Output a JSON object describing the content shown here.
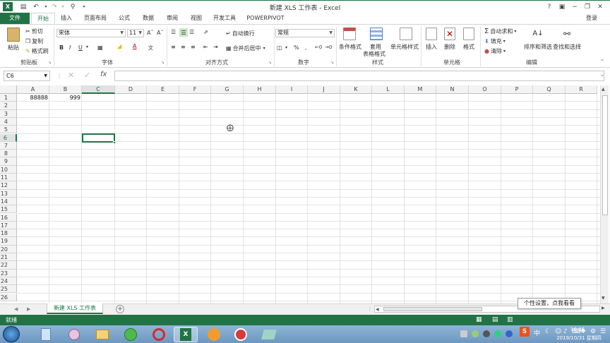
{
  "titlebar": {
    "title": "新建 XLS 工作表 - Excel",
    "help": "?",
    "minimize": "−",
    "restore": "❐",
    "close": "✕",
    "login": "登录"
  },
  "tabs": [
    "文件",
    "开始",
    "插入",
    "页面布局",
    "公式",
    "数据",
    "审阅",
    "视图",
    "开发工具",
    "POWERPIVOT"
  ],
  "ribbon": {
    "clipboard": {
      "paste": "粘贴",
      "cut": "剪切",
      "copy": "复制",
      "format_painter": "格式刷",
      "label": "剪贴板"
    },
    "font": {
      "name": "宋体",
      "size": "11",
      "bold": "B",
      "italic": "I",
      "underline": "U",
      "label": "字体"
    },
    "align": {
      "wrap": "自动换行",
      "merge": "合并后居中",
      "label": "对齐方式"
    },
    "number": {
      "format": "常规",
      "percent": "%",
      "comma": ",",
      "label": "数字"
    },
    "styles": {
      "conditional": "条件格式",
      "table1": "套用",
      "table2": "表格格式",
      "cell_styles": "单元格样式",
      "label": "样式"
    },
    "cells": {
      "insert": "插入",
      "delete": "删除",
      "format": "格式",
      "label": "单元格"
    },
    "editing": {
      "autosum": "自动求和",
      "fill": "填充",
      "clear": "清除",
      "sort": "排序和筛选",
      "find": "查找和选择",
      "label": "编辑"
    }
  },
  "formula_bar": {
    "name_box": "C6",
    "fx": "fx",
    "value": ""
  },
  "columns": [
    "A",
    "B",
    "C",
    "D",
    "E",
    "F",
    "G",
    "H",
    "I",
    "J",
    "K",
    "L",
    "M",
    "N",
    "O",
    "P",
    "Q",
    "R"
  ],
  "rows": [
    "1",
    "2",
    "3",
    "4",
    "5",
    "6",
    "7",
    "8",
    "9",
    "10",
    "11",
    "12",
    "13",
    "14",
    "15",
    "16",
    "17",
    "18",
    "19",
    "20",
    "21",
    "22",
    "23",
    "24",
    "25",
    "26"
  ],
  "cells": {
    "A1": "88888",
    "B1": "999"
  },
  "selected_cell": "C6",
  "sheet": {
    "tab": "新建 XLS 工作表",
    "add": "+",
    "prev": "◀",
    "next": "▶"
  },
  "status": {
    "ready": "就绪",
    "tooltip": "个性设置，点我看看"
  },
  "taskbar": {
    "time": "16:06",
    "date": "2019/10/31 星期四",
    "ime": "中"
  }
}
